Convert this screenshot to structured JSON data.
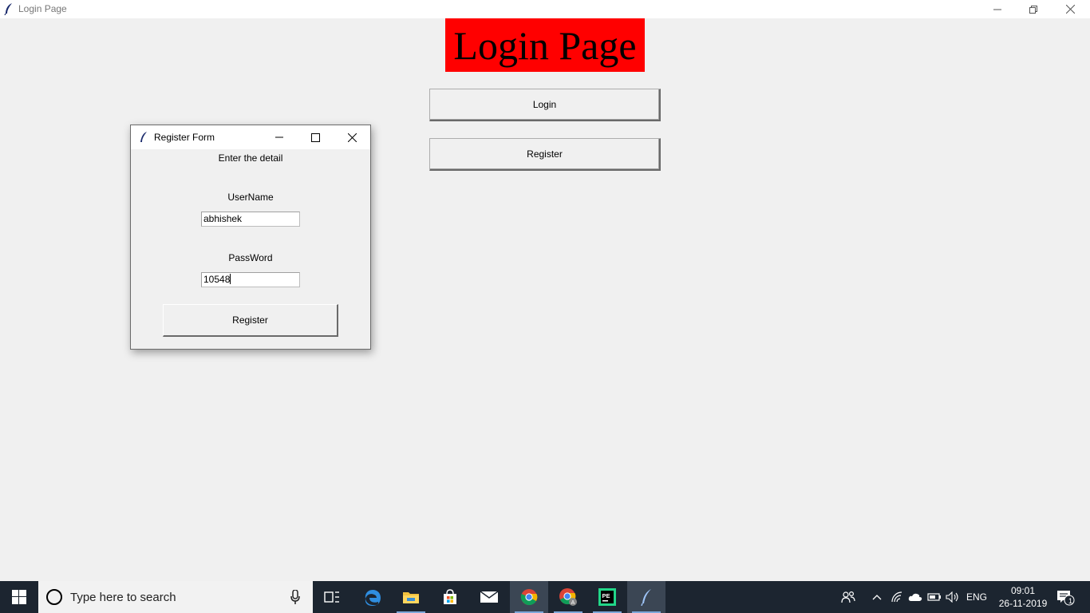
{
  "window": {
    "title": "Login Page"
  },
  "main": {
    "heading": "Login Page",
    "login_button": "Login",
    "register_button": "Register"
  },
  "register_dialog": {
    "title": "Register Form",
    "instruction": "Enter the detail",
    "username_label": "UserName",
    "username_value": "abhishek",
    "password_label": "PassWord",
    "password_value": "10548",
    "register_button": "Register"
  },
  "taskbar": {
    "search_placeholder": "Type here to search",
    "pinned_icons": [
      "start-icon",
      "task-view-icon",
      "edge-icon",
      "file-explorer-icon",
      "store-icon",
      "mail-icon",
      "chrome-icon",
      "chrome-profile-icon",
      "pycharm-edu-icon",
      "python-tk-icon"
    ],
    "language": "ENG",
    "time": "09:01",
    "date": "26-11-2019",
    "notification_count": "1"
  },
  "colors": {
    "heading_bg": "#ff0000",
    "taskbar_bg": "#1c2530",
    "window_bg": "#f0f0f0"
  }
}
